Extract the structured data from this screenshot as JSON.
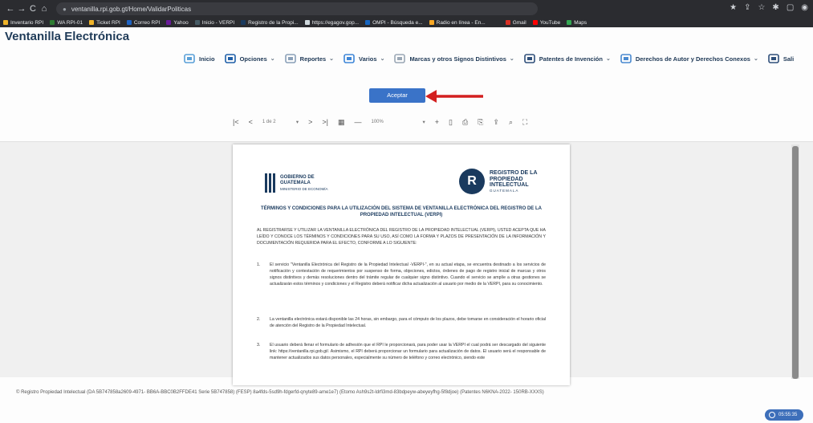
{
  "browser": {
    "url": "ventanilla.rpi.gob.gt/Home/ValidarPoliticas",
    "nav": [
      "←",
      "→",
      "C",
      "⌂"
    ],
    "window_controls": [
      "★",
      "⇪",
      "☆",
      "✱",
      "▢",
      "◉"
    ],
    "bookmarks": [
      {
        "label": "Inventario RPI",
        "color": "#f0b429"
      },
      {
        "label": "WA RPI-01",
        "color": "#2e7d32"
      },
      {
        "label": "Ticket RPI",
        "color": "#f0b429"
      },
      {
        "label": "Correo RPI",
        "color": "#1e63c4"
      },
      {
        "label": "Yahoo",
        "color": "#6a1b9a"
      },
      {
        "label": "Inicio - VERPI",
        "color": "#455a64"
      },
      {
        "label": "Registro de la Propi...",
        "color": "#1a3a5e"
      },
      {
        "label": "https://egagov.gop...",
        "color": "#cfd8dc"
      },
      {
        "label": "OMPI - Búsqueda e...",
        "color": "#1565c0"
      },
      {
        "label": "Radio en línea - En...",
        "color": "#f9a825"
      },
      {
        "label": "",
        "color": "#2b2c30"
      },
      {
        "label": "Gmail",
        "color": "#d93025"
      },
      {
        "label": "YouTube",
        "color": "#ff0000"
      },
      {
        "label": "Maps",
        "color": "#34a853"
      }
    ]
  },
  "app": {
    "title": "Ventanilla Electrónica",
    "menu": [
      {
        "label": "Inicio",
        "icon": "home-icon",
        "chevron": false
      },
      {
        "label": "Opciones",
        "icon": "gear-icon",
        "chevron": true
      },
      {
        "label": "Reportes",
        "icon": "report-icon",
        "chevron": true
      },
      {
        "label": "Varios",
        "icon": "grid-icon",
        "chevron": true
      },
      {
        "label": "Marcas y otros Signos Distintivos",
        "icon": "list-icon",
        "chevron": true
      },
      {
        "label": "Patentes de Invención",
        "icon": "factory-icon",
        "chevron": true
      },
      {
        "label": "Derechos de Autor y Derechos Conexos",
        "icon": "copyright-icon",
        "chevron": true
      },
      {
        "label": "Sali",
        "icon": "exit-icon",
        "chevron": false
      }
    ],
    "accept_button": "Aceptar"
  },
  "pdf_toolbar": {
    "first": "|<",
    "prev": "<",
    "page": "1 de 2",
    "next": ">",
    "last": ">|",
    "zoom": "100%",
    "minus": "—",
    "plus": "+",
    "dropdown": "▾"
  },
  "document": {
    "gov_logo": "GOBIERNO DE GUATEMALA",
    "gov_sub": "MINISTERIO DE ECONOMÍA",
    "rpi_logo": "REGISTRO DE LA PROPIEDAD INTELECTUAL",
    "rpi_letter": "R",
    "rpi_country": "GUATEMALA",
    "title": "TÉRMINOS Y CONDICIONES PARA LA UTILIZACIÓN DEL SISTEMA DE VENTANILLA ELECTRÓNICA DEL REGISTRO DE LA PROPIEDAD INTELECTUAL (VERPI)",
    "intro": "AL REGISTRARSE Y UTILIZAR LA VENTANILLA ELECTRÓNICA DEL REGISTRO DE LA PROPIEDAD INTELECTUAL (VERPI), USTED ACEPTA QUE HA LEÍDO Y CONOCE LOS TÉRMINOS Y CONDICIONES PARA SU USO, ASÍ COMO LA FORMA Y PLAZOS DE PRESENTACIÓN DE LA INFORMACIÓN Y DOCUMENTACIÓN REQUERIDA PARA EL EFECTO, CONFORME A LO SIGUIENTE:",
    "items": [
      {
        "num": "1.",
        "text": "El servicio \"Ventanilla Electrónica del Registro de la Propiedad Intelectual -VERPI-\", en su actual etapa, se encuentra destinado a los servicios de notificación y contestación de requerimientos por suspenso de forma, objeciones, edictos, órdenes de pago de registro inicial de marcas y otros signos distintivos y demás resoluciones dentro del trámite regular de cualquier signo distintivo. Cuando el servicio se amplíe a otras gestiones se actualizarán estos términos y condiciones y el Registro deberá notificar dicha actualización al usuario por medio de la VERPI, para su conocimiento."
      },
      {
        "num": "2.",
        "text": "La ventanilla electrónica estará disponible las 24 horas, sin embargo, para el cómputo de los plazos, debe tomarse en consideración el horario oficial de atención del Registro de la Propiedad Intelectual."
      },
      {
        "num": "3.",
        "text": "El usuario deberá llenar el formulario de adhesión que el RPI le proporcionará, para poder usar la VERPI el cual podrá ser descargado del siguiente link: https://ventanilla.rpi.gob.gt/. Asimismo, el RPI deberá proporcionar un formulario para actualización de datos. El usuario será el responsable de mantener actualizados sus datos personales, especialmente su número de teléfono y correo electrónico, siendo este"
      }
    ]
  },
  "footer": "© Registro Propiedad Intelectual (DA 5B747858a2609-4971- BB6A-BBC0B2FFDE41 Serie 5B747858) (FESP) 8a4fds-5sd9h-fdgerfd-qnyte89-ame1e7) (Etomo Ash9s2t-ldrfi3md-83bdpeyw-abeyeyfhg-5f8djoe) (Patentes N6KNA-2022- 150RB-XXXS)",
  "status_pill": "05:55:35"
}
